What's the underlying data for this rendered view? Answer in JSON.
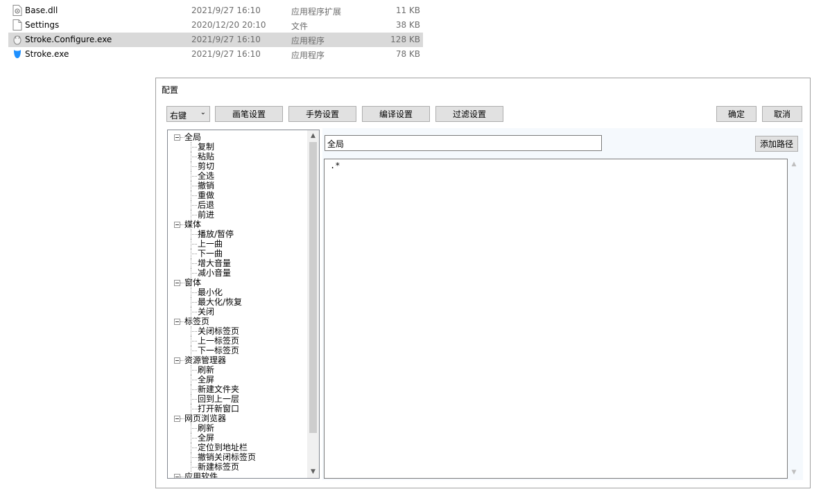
{
  "files": [
    {
      "name": "Base.dll",
      "date": "2021/9/27 16:10",
      "type": "应用程序扩展",
      "size": "11 KB",
      "icon": "dll-file-icon"
    },
    {
      "name": "Settings",
      "date": "2020/12/20 20:10",
      "type": "文件",
      "size": "38 KB",
      "icon": "blank-file-icon"
    },
    {
      "name": "Stroke.Configure.exe",
      "date": "2021/9/27 16:10",
      "type": "应用程序",
      "size": "128 KB",
      "icon": "stroke-configure-app-icon",
      "selected": true
    },
    {
      "name": "Stroke.exe",
      "date": "2021/9/27 16:10",
      "type": "应用程序",
      "size": "78 KB",
      "icon": "stroke-app-icon"
    }
  ],
  "dialog": {
    "title": "配置",
    "mouse_button": "右键",
    "toolbar": {
      "pen_settings": "画笔设置",
      "gesture_settings": "手势设置",
      "compile_settings": "编译设置",
      "filter_settings": "过滤设置",
      "ok": "确定",
      "cancel": "取消"
    },
    "tree": [
      {
        "label": "全局",
        "children": [
          "复制",
          "粘贴",
          "剪切",
          "全选",
          "撤销",
          "重做",
          "后退",
          "前进"
        ]
      },
      {
        "label": "媒体",
        "children": [
          "播放/暂停",
          "上一曲",
          "下一曲",
          "增大音量",
          "减小音量"
        ]
      },
      {
        "label": "窗体",
        "children": [
          "最小化",
          "最大化/恢复",
          "关闭"
        ]
      },
      {
        "label": "标签页",
        "children": [
          "关闭标签页",
          "上一标签页",
          "下一标签页"
        ]
      },
      {
        "label": "资源管理器",
        "children": [
          "刷新",
          "全屏",
          "新建文件夹",
          "回到上一层",
          "打开新窗口"
        ]
      },
      {
        "label": "网页浏览器",
        "children": [
          "刷新",
          "全屏",
          "定位到地址栏",
          "撤销关闭标签页",
          "新建标签页"
        ]
      },
      {
        "label": "应用软件",
        "children": []
      }
    ],
    "path_value": "全局",
    "add_path": "添加路径",
    "regex_text": ".*"
  }
}
